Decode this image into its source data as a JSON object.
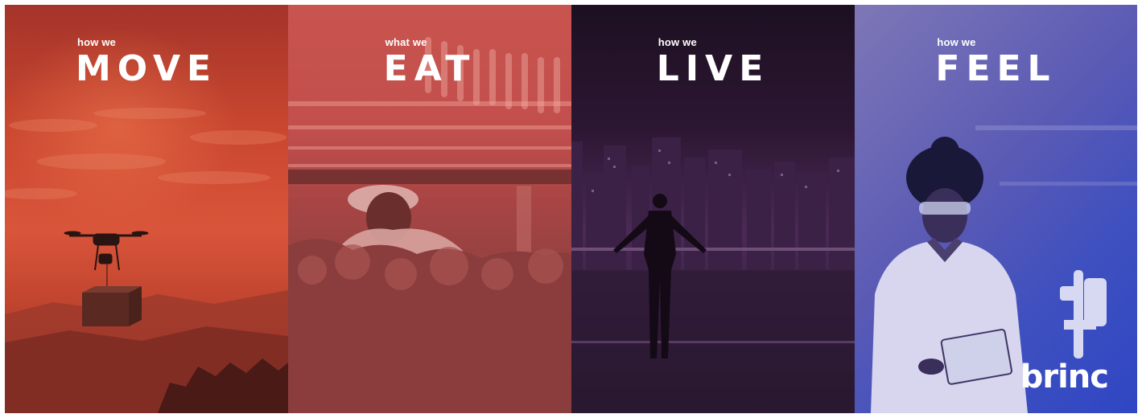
{
  "panels": [
    {
      "eyebrow": "how we",
      "headline": "MOVE",
      "scene": "drone-delivery"
    },
    {
      "eyebrow": "what we",
      "headline": "EAT",
      "scene": "indoor-farm"
    },
    {
      "eyebrow": "how we",
      "headline": "LIVE",
      "scene": "city-skyline"
    },
    {
      "eyebrow": "how we",
      "headline": "FEEL",
      "scene": "lab-scientist"
    }
  ],
  "brand": {
    "logo_text": "brinc"
  },
  "colors": {
    "move": "#c9462f",
    "eat": "#c24f4c",
    "live": "#2c1632",
    "feel": "#3f50bf",
    "text": "#ffffff"
  }
}
